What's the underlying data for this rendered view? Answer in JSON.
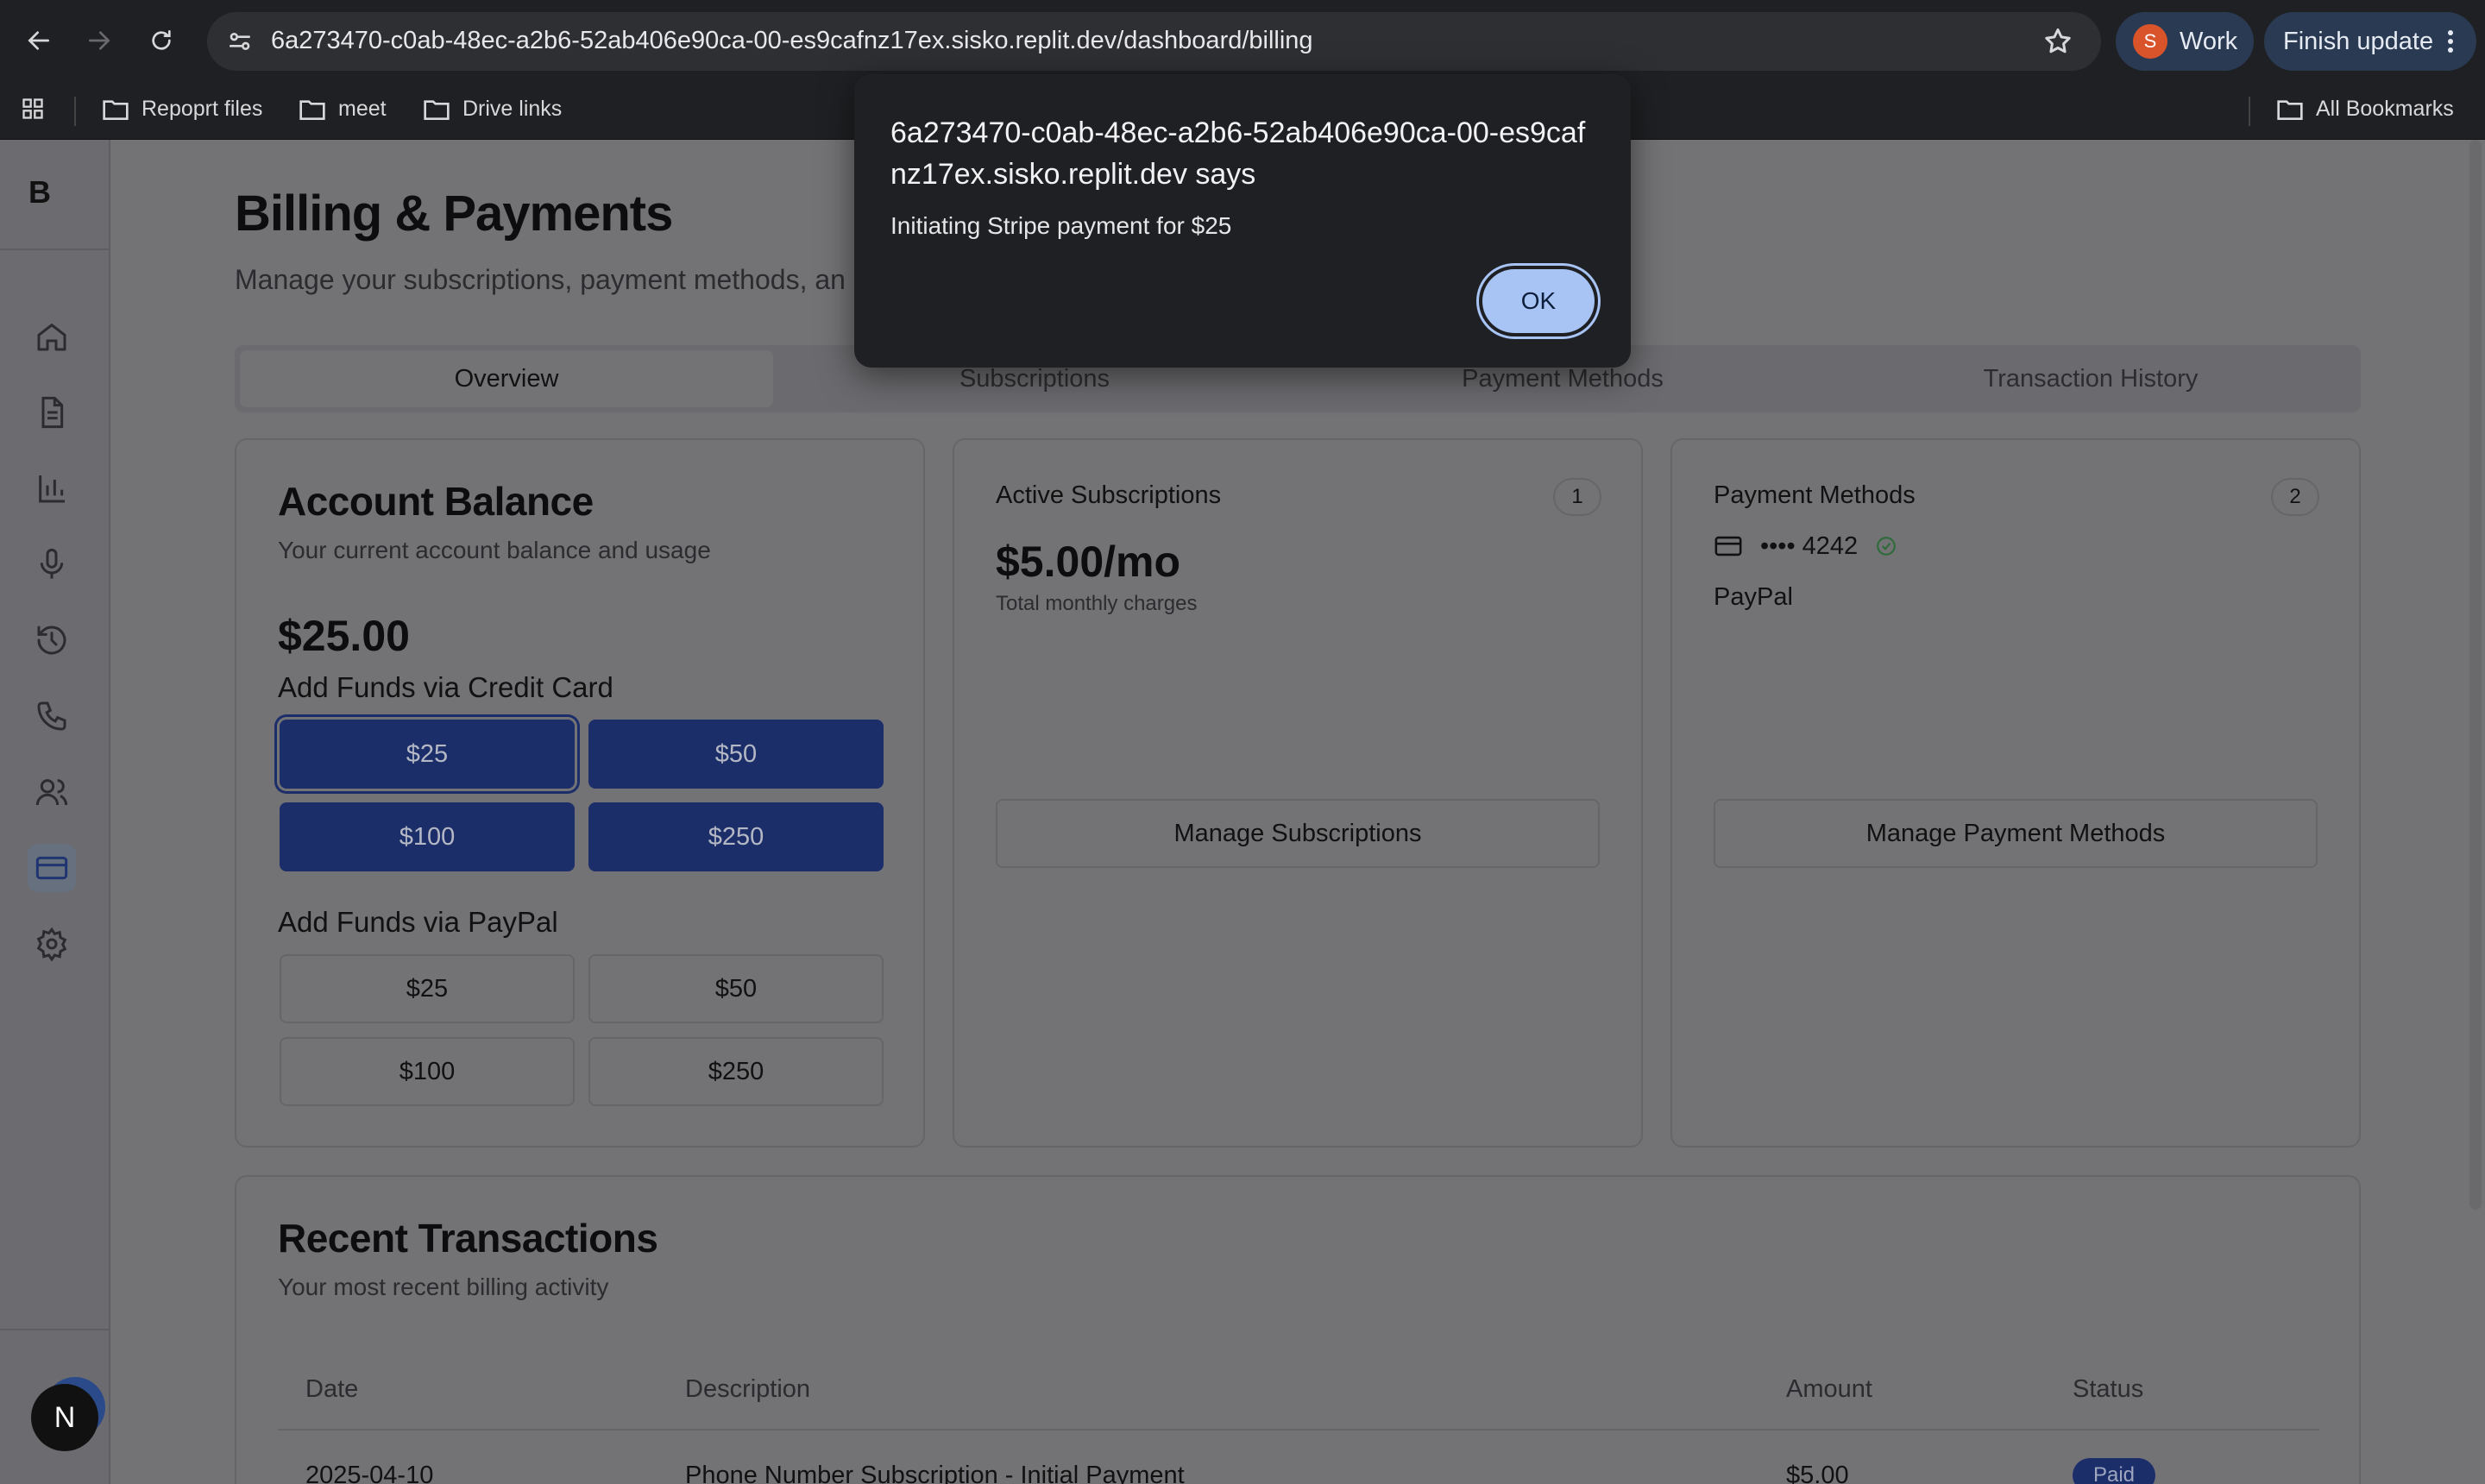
{
  "browser": {
    "url": "6a273470-c0ab-48ec-a2b6-52ab406e90ca-00-es9cafnz17ex.sisko.replit.dev/dashboard/billing",
    "profile_initial": "S",
    "profile_label": "Work",
    "finish_update_label": "Finish update",
    "bookmarks": [
      "Repoprt files",
      "meet",
      "Drive links"
    ],
    "all_bookmarks_label": "All Bookmarks"
  },
  "sidebar": {
    "logo": "B",
    "icons": [
      "home-icon",
      "document-icon",
      "bar-chart-icon",
      "microphone-icon",
      "history-icon",
      "phone-icon",
      "users-icon",
      "credit-card-icon",
      "settings-icon"
    ],
    "active": "credit-card-icon",
    "user_initial": "N"
  },
  "header": {
    "title": "Billing & Payments",
    "subtitle": "Manage your subscriptions, payment methods, an"
  },
  "tabs": [
    "Overview",
    "Subscriptions",
    "Payment Methods",
    "Transaction History"
  ],
  "account_balance": {
    "title": "Account Balance",
    "description": "Your current account balance and usage",
    "balance": "$25.00",
    "credit_card_label": "Add Funds via Credit Card",
    "credit_card_amounts": [
      "$25",
      "$50",
      "$100",
      "$250"
    ],
    "paypal_label": "Add Funds via PayPal",
    "paypal_amounts": [
      "$25",
      "$50",
      "$100",
      "$250"
    ]
  },
  "active_subscriptions": {
    "title": "Active Subscriptions",
    "count": "1",
    "amount": "$5.00/mo",
    "caption": "Total monthly charges",
    "button": "Manage Subscriptions"
  },
  "payment_methods": {
    "title": "Payment Methods",
    "count": "2",
    "card_masked": "•••• 4242",
    "paypal": "PayPal",
    "button": "Manage Payment Methods"
  },
  "recent_transactions": {
    "title": "Recent Transactions",
    "description": "Your most recent billing activity",
    "columns": [
      "Date",
      "Description",
      "Amount",
      "Status"
    ],
    "rows": [
      {
        "date": "2025-04-10",
        "description": "Phone Number Subscription - Initial Payment",
        "amount": "$5.00",
        "status": "Paid"
      }
    ]
  },
  "dialog": {
    "title": "6a273470-c0ab-48ec-a2b6-52ab406e90ca-00-es9cafnz17ex.sisko.replit.dev says",
    "message": "Initiating Stripe payment for $25",
    "ok_label": "OK"
  }
}
